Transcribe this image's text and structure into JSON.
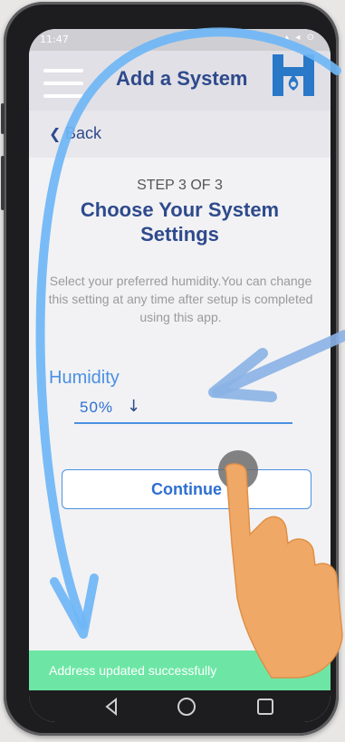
{
  "status_bar": {
    "time": "11:47",
    "icons": "▴ ◂ ⊙"
  },
  "app_bar": {
    "title": "Add a System",
    "logo_icon": "h-droplet-logo"
  },
  "back": {
    "label": "Back",
    "icon": "chevron-left-icon"
  },
  "step": {
    "label": "STEP 3 OF 3"
  },
  "heading": {
    "line1": "Choose Your System",
    "line2": "Settings"
  },
  "description": "Select your preferred humidity.You can change this setting at any time after setup is completed using this app.",
  "humidity": {
    "label": "Humidity",
    "value": "50%",
    "dropdown_icon": "↓"
  },
  "continue_button": {
    "label": "Continue"
  },
  "toast": {
    "message": "Address updated successfully"
  },
  "colors": {
    "accent": "#2e4a8c",
    "link": "#4a90e2",
    "toast": "#6de6a5",
    "arrow_overlay": "#6fb6f5",
    "hand": "#f0a866"
  }
}
